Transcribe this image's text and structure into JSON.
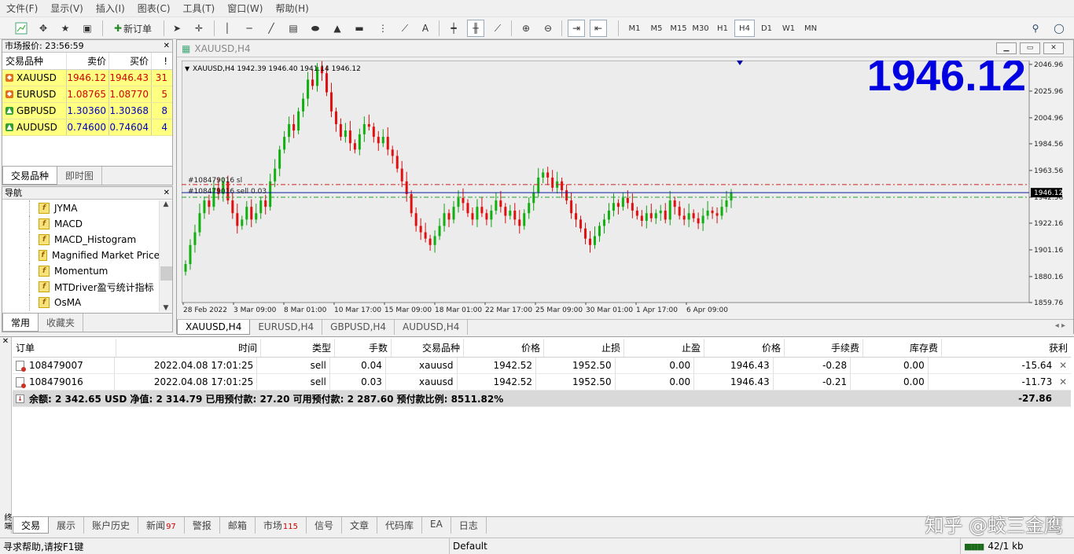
{
  "menu": [
    "文件(F)",
    "显示(V)",
    "插入(I)",
    "图表(C)",
    "工具(T)",
    "窗口(W)",
    "帮助(H)"
  ],
  "toolbar": {
    "new_order_label": "新订单",
    "text_tool": "A",
    "timeframes": [
      "M1",
      "M5",
      "M15",
      "M30",
      "H1",
      "H4",
      "D1",
      "W1",
      "MN"
    ],
    "active_timeframe": "H4"
  },
  "market_watch": {
    "title": "市场报价: 23:56:59",
    "headers": {
      "symbol": "交易品种",
      "bid": "卖价",
      "ask": "买价",
      "spread": "!"
    },
    "rows": [
      {
        "symbol": "XAUUSD",
        "bid": "1946.12",
        "ask": "1946.43",
        "spread": "31",
        "dir": "down"
      },
      {
        "symbol": "EURUSD",
        "bid": "1.08765",
        "ask": "1.08770",
        "spread": "5",
        "dir": "down"
      },
      {
        "symbol": "GBPUSD",
        "bid": "1.30360",
        "ask": "1.30368",
        "spread": "8",
        "dir": "up"
      },
      {
        "symbol": "AUDUSD",
        "bid": "0.74600",
        "ask": "0.74604",
        "spread": "4",
        "dir": "up"
      }
    ],
    "tabs": [
      "交易品种",
      "即时图"
    ]
  },
  "navigator": {
    "title": "导航",
    "items": [
      "JYMA",
      "MACD",
      "MACD_Histogram",
      "Magnified Market Price",
      "Momentum",
      "MTDriver盈亏统计指标",
      "OsMA"
    ],
    "tabs": [
      "常用",
      "收藏夹"
    ]
  },
  "chart_window": {
    "title": "XAUUSD,H4",
    "tabs": [
      "XAUUSD,H4",
      "EURUSD,H4",
      "GBPUSD,H4",
      "AUDUSD,H4"
    ]
  },
  "chart_data": {
    "type": "candlestick",
    "symbol_info": "XAUUSD,H4  1942.39 1946.40 1941.14 1946.12",
    "big_price": "1946.12",
    "current_price": "1946.12",
    "y_ticks": [
      "2046.96",
      "2025.96",
      "2004.96",
      "1984.56",
      "1963.56",
      "1942.56",
      "1922.16",
      "1901.16",
      "1880.16",
      "1859.76"
    ],
    "x_ticks": [
      "28 Feb 2022",
      "3 Mar 09:00",
      "8 Mar 01:00",
      "10 Mar 17:00",
      "15 Mar 09:00",
      "18 Mar 01:00",
      "22 Mar 17:00",
      "25 Mar 09:00",
      "30 Mar 01:00",
      "1 Apr 17:00",
      "6 Apr 09:00"
    ],
    "ylim": [
      1859.76,
      2050
    ],
    "sl_level": 1952.5,
    "entry_level": 1942.52,
    "bid_level": 1946.12,
    "order_label_sl": "#108479016 sl",
    "order_label_entry": "#108479016 sell 0.03",
    "closes": [
      1890,
      1905,
      1915,
      1930,
      1940,
      1935,
      1950,
      1945,
      1955,
      1940,
      1930,
      1920,
      1925,
      1935,
      1925,
      1930,
      1940,
      1935,
      1955,
      1965,
      1980,
      1990,
      2000,
      1995,
      2010,
      2020,
      2035,
      2030,
      2045,
      2040,
      2025,
      2010,
      2000,
      1990,
      1995,
      1985,
      1980,
      1992,
      2000,
      1998,
      1990,
      1985,
      1990,
      1980,
      1975,
      1965,
      1955,
      1945,
      1930,
      1920,
      1915,
      1910,
      1905,
      1912,
      1920,
      1930,
      1925,
      1935,
      1942,
      1938,
      1930,
      1925,
      1935,
      1930,
      1925,
      1932,
      1940,
      1935,
      1928,
      1932,
      1925,
      1920,
      1930,
      1938,
      1946,
      1958,
      1962,
      1958,
      1950,
      1955,
      1948,
      1940,
      1930,
      1925,
      1918,
      1910,
      1905,
      1912,
      1920,
      1925,
      1932,
      1938,
      1935,
      1942,
      1938,
      1932,
      1928,
      1924,
      1930,
      1926,
      1930,
      1932,
      1925,
      1940,
      1935,
      1928,
      1925,
      1930,
      1926,
      1922,
      1928,
      1932,
      1930,
      1928,
      1935,
      1940,
      1946
    ]
  },
  "terminal": {
    "headers": [
      "订单",
      "时间",
      "类型",
      "手数",
      "交易品种",
      "价格",
      "止损",
      "止盈",
      "价格",
      "手续费",
      "库存费",
      "获利"
    ],
    "rows": [
      {
        "order": "108479007",
        "time": "2022.04.08 17:01:25",
        "type": "sell",
        "lots": "0.04",
        "symbol": "xauusd",
        "price": "1942.52",
        "sl": "1952.50",
        "tp": "0.00",
        "cur": "1946.43",
        "comm": "-0.28",
        "swap": "0.00",
        "profit": "-15.64"
      },
      {
        "order": "108479016",
        "time": "2022.04.08 17:01:25",
        "type": "sell",
        "lots": "0.03",
        "symbol": "xauusd",
        "price": "1942.52",
        "sl": "1952.50",
        "tp": "0.00",
        "cur": "1946.43",
        "comm": "-0.21",
        "swap": "0.00",
        "profit": "-11.73"
      }
    ],
    "summary": "余额: 2 342.65 USD  净值: 2 314.79  已用预付款: 27.20  可用预付款: 2 287.60  预付款比例: 8511.82%",
    "total_profit": "-27.86",
    "side_label": "终端",
    "tabs": [
      {
        "label": "交易",
        "badge": ""
      },
      {
        "label": "展示",
        "badge": ""
      },
      {
        "label": "账户历史",
        "badge": ""
      },
      {
        "label": "新闻",
        "badge": "97"
      },
      {
        "label": "警报",
        "badge": ""
      },
      {
        "label": "邮箱",
        "badge": ""
      },
      {
        "label": "市场",
        "badge": "115"
      },
      {
        "label": "信号",
        "badge": ""
      },
      {
        "label": "文章",
        "badge": ""
      },
      {
        "label": "代码库",
        "badge": ""
      },
      {
        "label": "EA",
        "badge": ""
      },
      {
        "label": "日志",
        "badge": ""
      }
    ]
  },
  "watermark": "知乎 @蛟三金鹰",
  "status": {
    "help": "寻求帮助,请按F1键",
    "profile": "Default",
    "traffic": "42/1 kb"
  }
}
